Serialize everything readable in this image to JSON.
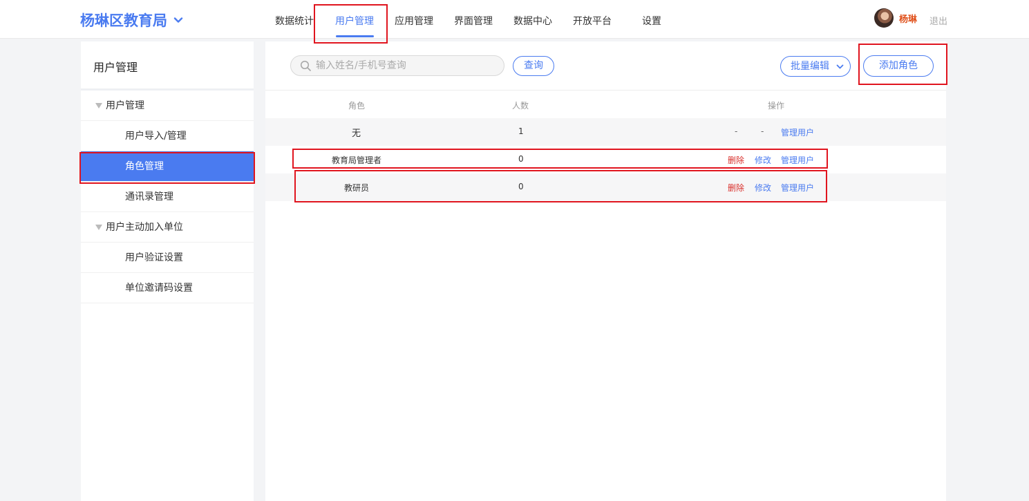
{
  "header": {
    "brand": "杨琳区教育局",
    "nav": [
      {
        "label": "数据统计",
        "active": false
      },
      {
        "label": "用户管理",
        "active": true
      },
      {
        "label": "应用管理",
        "active": false
      },
      {
        "label": "界面管理",
        "active": false
      },
      {
        "label": "数据中心",
        "active": false
      },
      {
        "label": "开放平台",
        "active": false
      },
      {
        "label": "设置",
        "active": false
      }
    ],
    "username": "杨琳",
    "logout": "退出"
  },
  "sidebar": {
    "title": "用户管理",
    "items": [
      {
        "label": "用户管理",
        "kind": "group"
      },
      {
        "label": "用户导入/管理",
        "kind": "sub"
      },
      {
        "label": "角色管理",
        "kind": "sub",
        "active": true
      },
      {
        "label": "通讯录管理",
        "kind": "sub"
      },
      {
        "label": "用户主动加入单位",
        "kind": "group"
      },
      {
        "label": "用户验证设置",
        "kind": "sub"
      },
      {
        "label": "单位邀请码设置",
        "kind": "sub"
      }
    ]
  },
  "toolbar": {
    "search_placeholder": "输入姓名/手机号查询",
    "query_label": "查询",
    "batch_label": "批量编辑",
    "add_role_label": "添加角色"
  },
  "table": {
    "headers": {
      "role": "角色",
      "count": "人数",
      "actions": "操作"
    },
    "rows": [
      {
        "role": "无",
        "count": "1",
        "delete": "-",
        "edit": "-",
        "manage": "管理用户"
      },
      {
        "role": "教育局管理者",
        "count": "0",
        "delete": "删除",
        "edit": "修改",
        "manage": "管理用户"
      },
      {
        "role": "教研员",
        "count": "0",
        "delete": "删除",
        "edit": "修改",
        "manage": "管理用户"
      }
    ]
  },
  "colors": {
    "accent": "#4a7bf0",
    "danger": "#d9312d",
    "highlight": "#e0141e",
    "username": "#e0501a"
  }
}
